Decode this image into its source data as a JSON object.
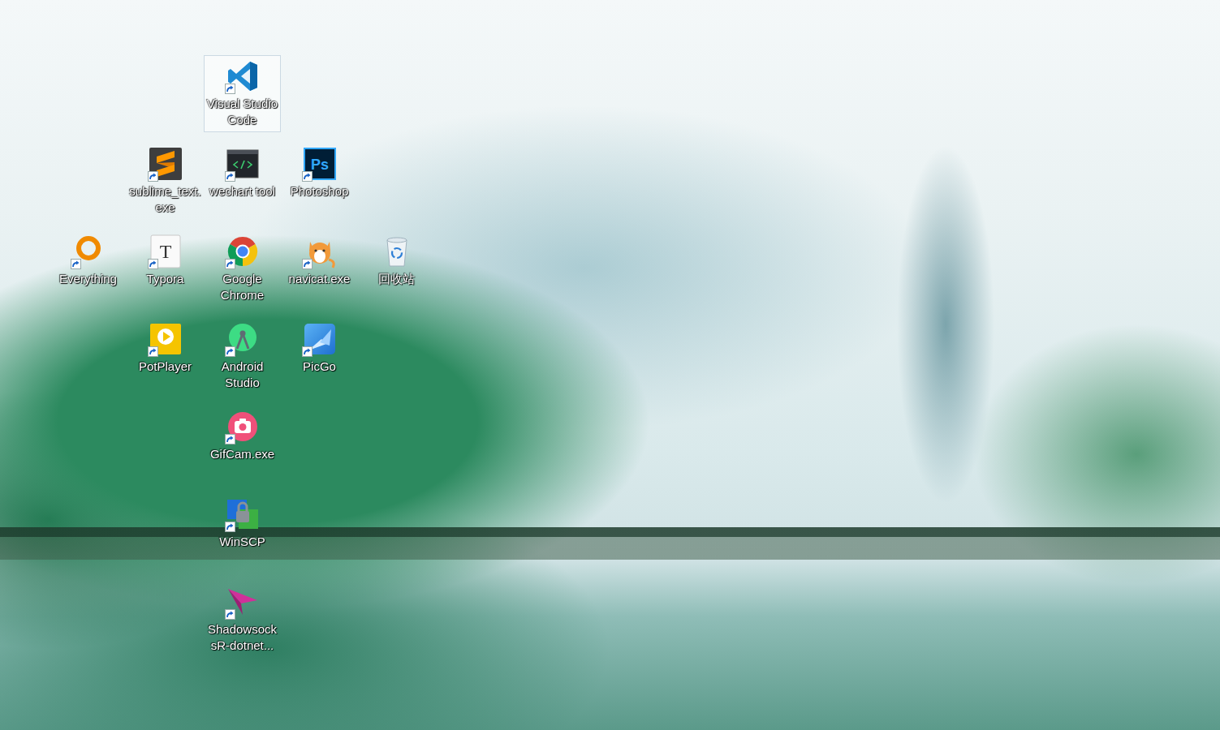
{
  "desktop": {
    "icons": [
      {
        "label": "Visual Studio Code",
        "selected": true,
        "shortcut": true
      },
      {
        "label": "sublime_text.exe",
        "selected": false,
        "shortcut": true
      },
      {
        "label": "wechart tool",
        "selected": false,
        "shortcut": true
      },
      {
        "label": "Photoshop",
        "selected": false,
        "shortcut": true,
        "glyph": "Ps"
      },
      {
        "label": "Everything",
        "selected": false,
        "shortcut": true
      },
      {
        "label": "Typora",
        "selected": false,
        "shortcut": true,
        "glyph": "T"
      },
      {
        "label": "Google Chrome",
        "selected": false,
        "shortcut": true
      },
      {
        "label": "navicat.exe",
        "selected": false,
        "shortcut": true
      },
      {
        "label": "回收站",
        "selected": false,
        "shortcut": false
      },
      {
        "label": "PotPlayer",
        "selected": false,
        "shortcut": true
      },
      {
        "label": "Android Studio",
        "selected": false,
        "shortcut": true
      },
      {
        "label": "PicGo",
        "selected": false,
        "shortcut": true
      },
      {
        "label": "GifCam.exe",
        "selected": false,
        "shortcut": true
      },
      {
        "label": "WinSCP",
        "selected": false,
        "shortcut": true
      },
      {
        "label": "ShadowsocksR-dotnet...",
        "selected": false,
        "shortcut": true
      }
    ]
  }
}
